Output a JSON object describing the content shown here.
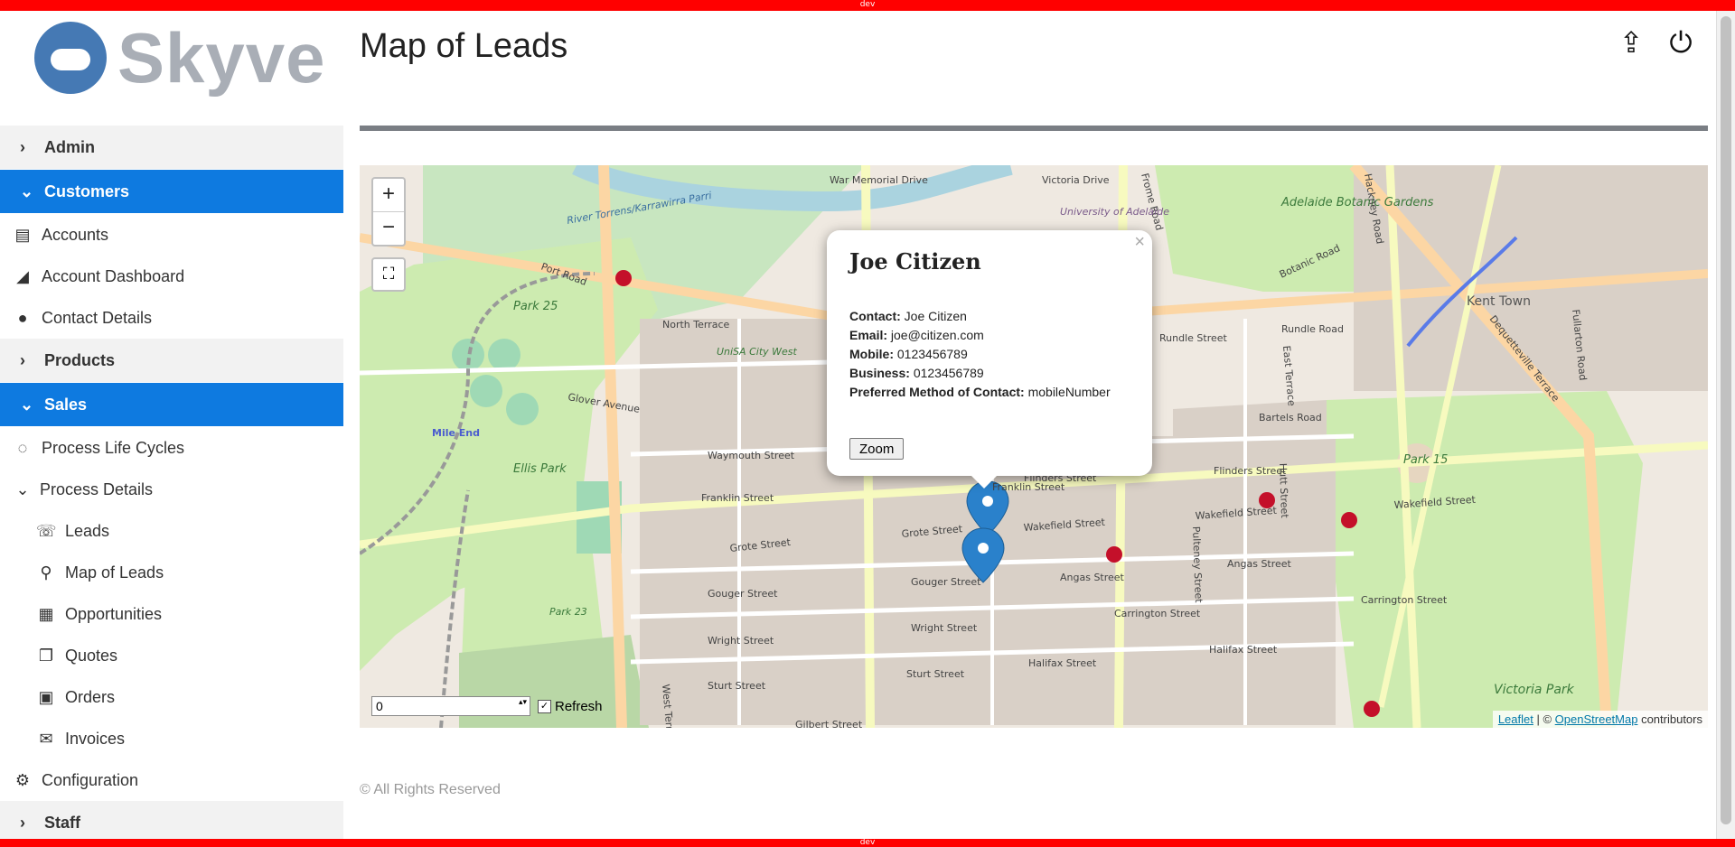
{
  "env": {
    "top_label": "dev",
    "bottom_label": "dev"
  },
  "logo": {
    "text": "Skyve"
  },
  "sidebar": {
    "groups": [
      {
        "label": "Admin",
        "expanded": false
      },
      {
        "label": "Customers",
        "expanded": true,
        "items": [
          {
            "label": "Accounts",
            "icon": "book-icon"
          },
          {
            "label": "Account Dashboard",
            "icon": "area-chart-icon"
          },
          {
            "label": "Contact Details",
            "icon": "users-icon"
          }
        ]
      },
      {
        "label": "Products",
        "expanded": false
      },
      {
        "label": "Sales",
        "expanded": true,
        "items": [
          {
            "label": "Process Life Cycles",
            "icon": "circle-notch-icon"
          },
          {
            "label": "Process Details",
            "icon": "chevron-down-icon",
            "children": [
              {
                "label": "Leads",
                "icon": "phone-icon"
              },
              {
                "label": "Map of Leads",
                "icon": "map-marker-icon"
              },
              {
                "label": "Opportunities",
                "icon": "newspaper-icon"
              },
              {
                "label": "Quotes",
                "icon": "clone-icon"
              },
              {
                "label": "Orders",
                "icon": "file-text-icon"
              },
              {
                "label": "Invoices",
                "icon": "envelope-icon"
              }
            ]
          }
        ]
      },
      {
        "label": "Configuration",
        "icon": "cogs-icon",
        "is_item": true
      },
      {
        "label": "Staff",
        "expanded": false
      }
    ]
  },
  "header": {
    "title": "Map of Leads",
    "share_icon": "share-icon",
    "power_icon": "power-icon"
  },
  "map": {
    "zoom_in": "+",
    "zoom_out": "−",
    "popup": {
      "title": "Joe Citizen",
      "close": "×",
      "fields": [
        {
          "label": "Contact:",
          "value": "Joe Citizen"
        },
        {
          "label": "Email:",
          "value": "joe@citizen.com"
        },
        {
          "label": "Mobile:",
          "value": "0123456789"
        },
        {
          "label": "Business:",
          "value": "0123456789"
        },
        {
          "label": "Preferred Method of Contact:",
          "value": "mobileNumber"
        }
      ],
      "zoom_button": "Zoom"
    },
    "refresh_value": "0",
    "refresh_label": "Refresh",
    "refresh_checked": true,
    "attribution": {
      "leaflet": "Leaflet",
      "sep": " | © ",
      "osm": "OpenStreetMap",
      "suffix": " contributors"
    },
    "street_labels": [
      "Port Road",
      "North Terrace",
      "Glover Avenue",
      "Mile End",
      "Ellis Park",
      "Park 25",
      "Park 23",
      "Waymouth Street",
      "Franklin Street",
      "Grote Street",
      "Gouger Street",
      "Wright Street",
      "Sturt Street",
      "Gilbert Street",
      "Wakefield Street",
      "Angas Street",
      "Carrington Street",
      "Halifax Street",
      "Flinders Street",
      "Rundle Street",
      "Rundle Road",
      "Bartels Road",
      "Botanic Road",
      "Park 15",
      "Victoria Park",
      "Kent Town",
      "Adelaide Botanic Gardens",
      "UniSA City West",
      "West Terrace",
      "East Terrace",
      "Hutt Street",
      "Pulteney Street",
      "Frome Road",
      "Fullarton Road",
      "Dequetteville Terrace",
      "Hackney Road",
      "War Memorial Drive",
      "Victoria Drive",
      "University of Adelaide",
      "River Torrens/Karrawirra Parri"
    ]
  },
  "footer": {
    "text": "© All Rights Reserved"
  },
  "colors": {
    "accent": "#0e7ae0",
    "divider": "#7a7e84",
    "marker": "#2a81cb"
  }
}
